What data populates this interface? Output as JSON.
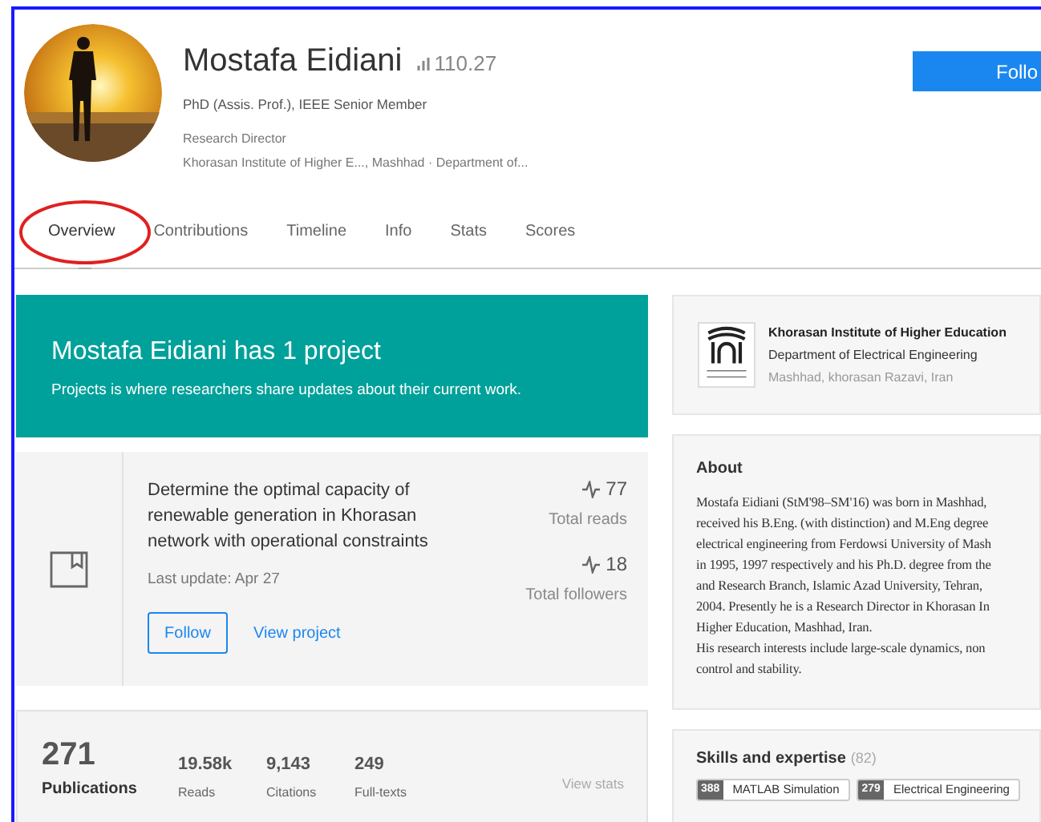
{
  "profile": {
    "name": "Mostafa Eidiani",
    "score": "110.27",
    "degree": "PhD (Assis. Prof.), IEEE Senior Member",
    "position": "Research Director",
    "affiliation": "Khorasan Institute of Higher E..., Mashhad · Department of...",
    "follow_button": "Follo"
  },
  "tabs": [
    {
      "label": "Overview",
      "selected": true,
      "circled": true
    },
    {
      "label": "Contributions",
      "selected": false,
      "circled": false
    },
    {
      "label": "Timeline",
      "selected": false,
      "circled": false
    },
    {
      "label": "Info",
      "selected": false,
      "circled": false
    },
    {
      "label": "Stats",
      "selected": false,
      "circled": false
    },
    {
      "label": "Scores",
      "selected": false,
      "circled": false
    }
  ],
  "projects_banner": {
    "title": "Mostafa Eidiani has 1 project",
    "subtitle": "Projects is where researchers share updates about their current work."
  },
  "project": {
    "title": "Determine the optimal capacity of renewable generation in Khorasan network with operational constraints",
    "last_update": "Last update: Apr 27",
    "follow_button": "Follow",
    "view_link": "View project",
    "stats": [
      {
        "value": "77",
        "label": "Total reads"
      },
      {
        "value": "18",
        "label": "Total followers"
      }
    ]
  },
  "publications": {
    "count": "271",
    "label": "Publications",
    "link": "View stats",
    "stats": [
      {
        "value": "19.58k",
        "label": "Reads"
      },
      {
        "value": "9,143",
        "label": "Citations"
      },
      {
        "value": "249",
        "label": "Full-texts"
      }
    ]
  },
  "institution": {
    "name": "Khorasan Institute of Higher Education",
    "department": "Department of Electrical Engineering",
    "location": "Mashhad, khorasan Razavi, Iran"
  },
  "about": {
    "title": "About",
    "lines": [
      "Mostafa Eidiani (StM'98–SM'16) was born in Mashhad,",
      "received his B.Eng. (with distinction) and M.Eng degree",
      "electrical engineering from Ferdowsi University of Mash",
      "in 1995, 1997 respectively and his Ph.D. degree from the",
      "and Research Branch, Islamic Azad University, Tehran,",
      "2004. Presently he is a Research Director in Khorasan In",
      "Higher Education, Mashhad, Iran.",
      "His research interests include large-scale dynamics, non",
      "control and stability."
    ]
  },
  "skills": {
    "title": "Skills and expertise",
    "count": "(82)",
    "items": [
      {
        "count": "388",
        "label": "MATLAB Simulation"
      },
      {
        "count": "279",
        "label": "Electrical Engineering"
      }
    ]
  }
}
